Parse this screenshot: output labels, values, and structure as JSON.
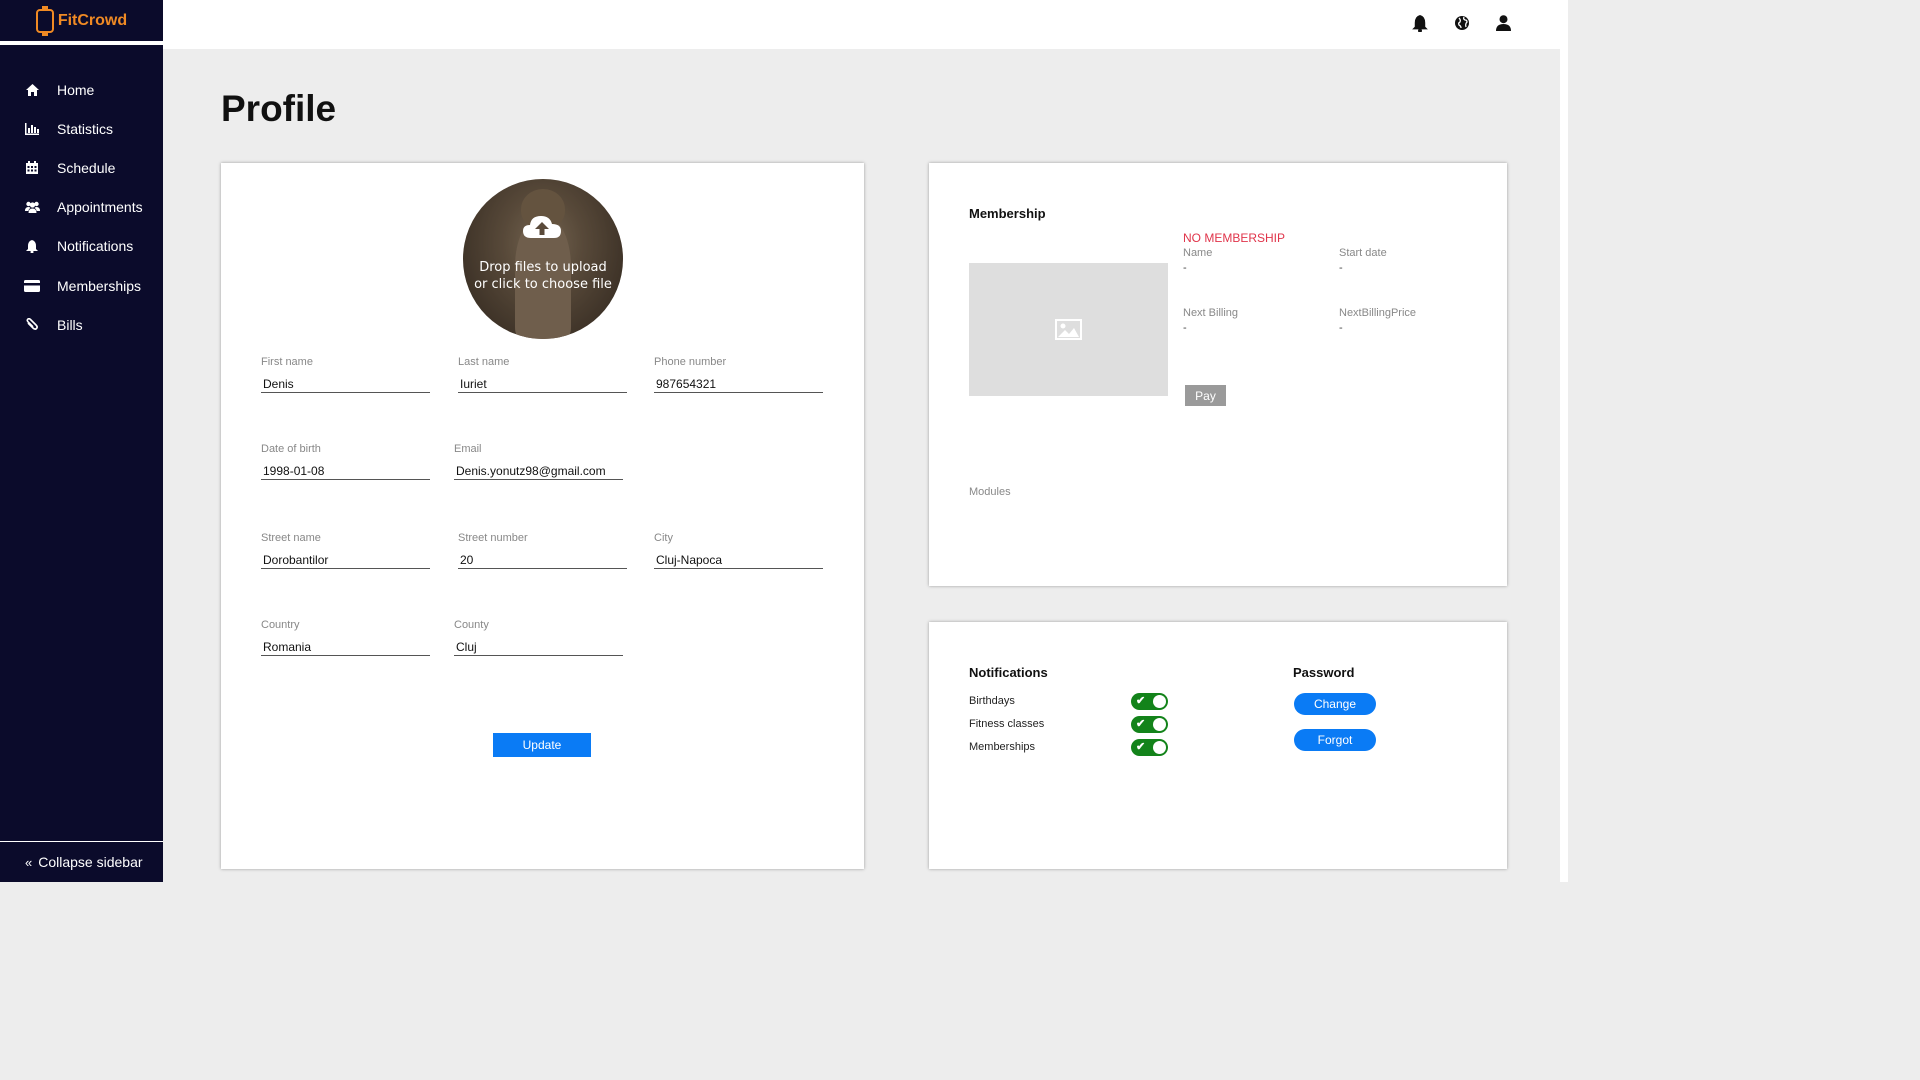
{
  "app": {
    "name": "FitCrowd"
  },
  "sidebar": {
    "items": [
      {
        "label": "Home",
        "icon": "home-icon"
      },
      {
        "label": "Statistics",
        "icon": "bar-chart-icon"
      },
      {
        "label": "Schedule",
        "icon": "calendar-icon"
      },
      {
        "label": "Appointments",
        "icon": "users-icon"
      },
      {
        "label": "Notifications",
        "icon": "bell-icon"
      },
      {
        "label": "Memberships",
        "icon": "credit-card-icon"
      },
      {
        "label": "Bills",
        "icon": "paperclip-icon"
      }
    ],
    "collapse_label": "Collapse sidebar"
  },
  "topbar": {
    "icons": [
      "bell-icon",
      "globe-icon",
      "user-icon"
    ]
  },
  "page": {
    "title": "Profile"
  },
  "profile": {
    "upload_text": "Drop files to upload or click to choose file",
    "fields": {
      "first_name": {
        "label": "First name",
        "value": "Denis"
      },
      "last_name": {
        "label": "Last name",
        "value": "Iuriet"
      },
      "phone": {
        "label": "Phone number",
        "value": "987654321"
      },
      "dob": {
        "label": "Date of birth",
        "value": "1998-01-08"
      },
      "email": {
        "label": "Email",
        "value": "Denis.yonutz98@gmail.com"
      },
      "street_name": {
        "label": "Street name",
        "value": "Dorobantilor"
      },
      "street_number": {
        "label": "Street number",
        "value": "20"
      },
      "city": {
        "label": "City",
        "value": "Cluj-Napoca"
      },
      "country": {
        "label": "Country",
        "value": "Romania"
      },
      "county": {
        "label": "County",
        "value": "Cluj"
      }
    },
    "update_label": "Update"
  },
  "membership": {
    "title": "Membership",
    "status": "NO MEMBERSHIP",
    "name_label": "Name",
    "name_value": "-",
    "start_label": "Start date",
    "start_value": "-",
    "next_billing_label": "Next Billing",
    "next_billing_value": "-",
    "next_price_label": "NextBillingPrice",
    "next_price_value": "-",
    "pay_label": "Pay",
    "modules_label": "Modules"
  },
  "notifications": {
    "title": "Notifications",
    "items": [
      {
        "label": "Birthdays",
        "enabled": true
      },
      {
        "label": "Fitness classes",
        "enabled": true
      },
      {
        "label": "Memberships",
        "enabled": true
      }
    ]
  },
  "password": {
    "title": "Password",
    "change_label": "Change",
    "forgot_label": "Forgot"
  },
  "colors": {
    "sidebar_bg": "#0b0b2b",
    "brand": "#f08a24",
    "accent": "#0a7bf5",
    "toggle_on": "#13831a",
    "alert": "#e0344a"
  }
}
